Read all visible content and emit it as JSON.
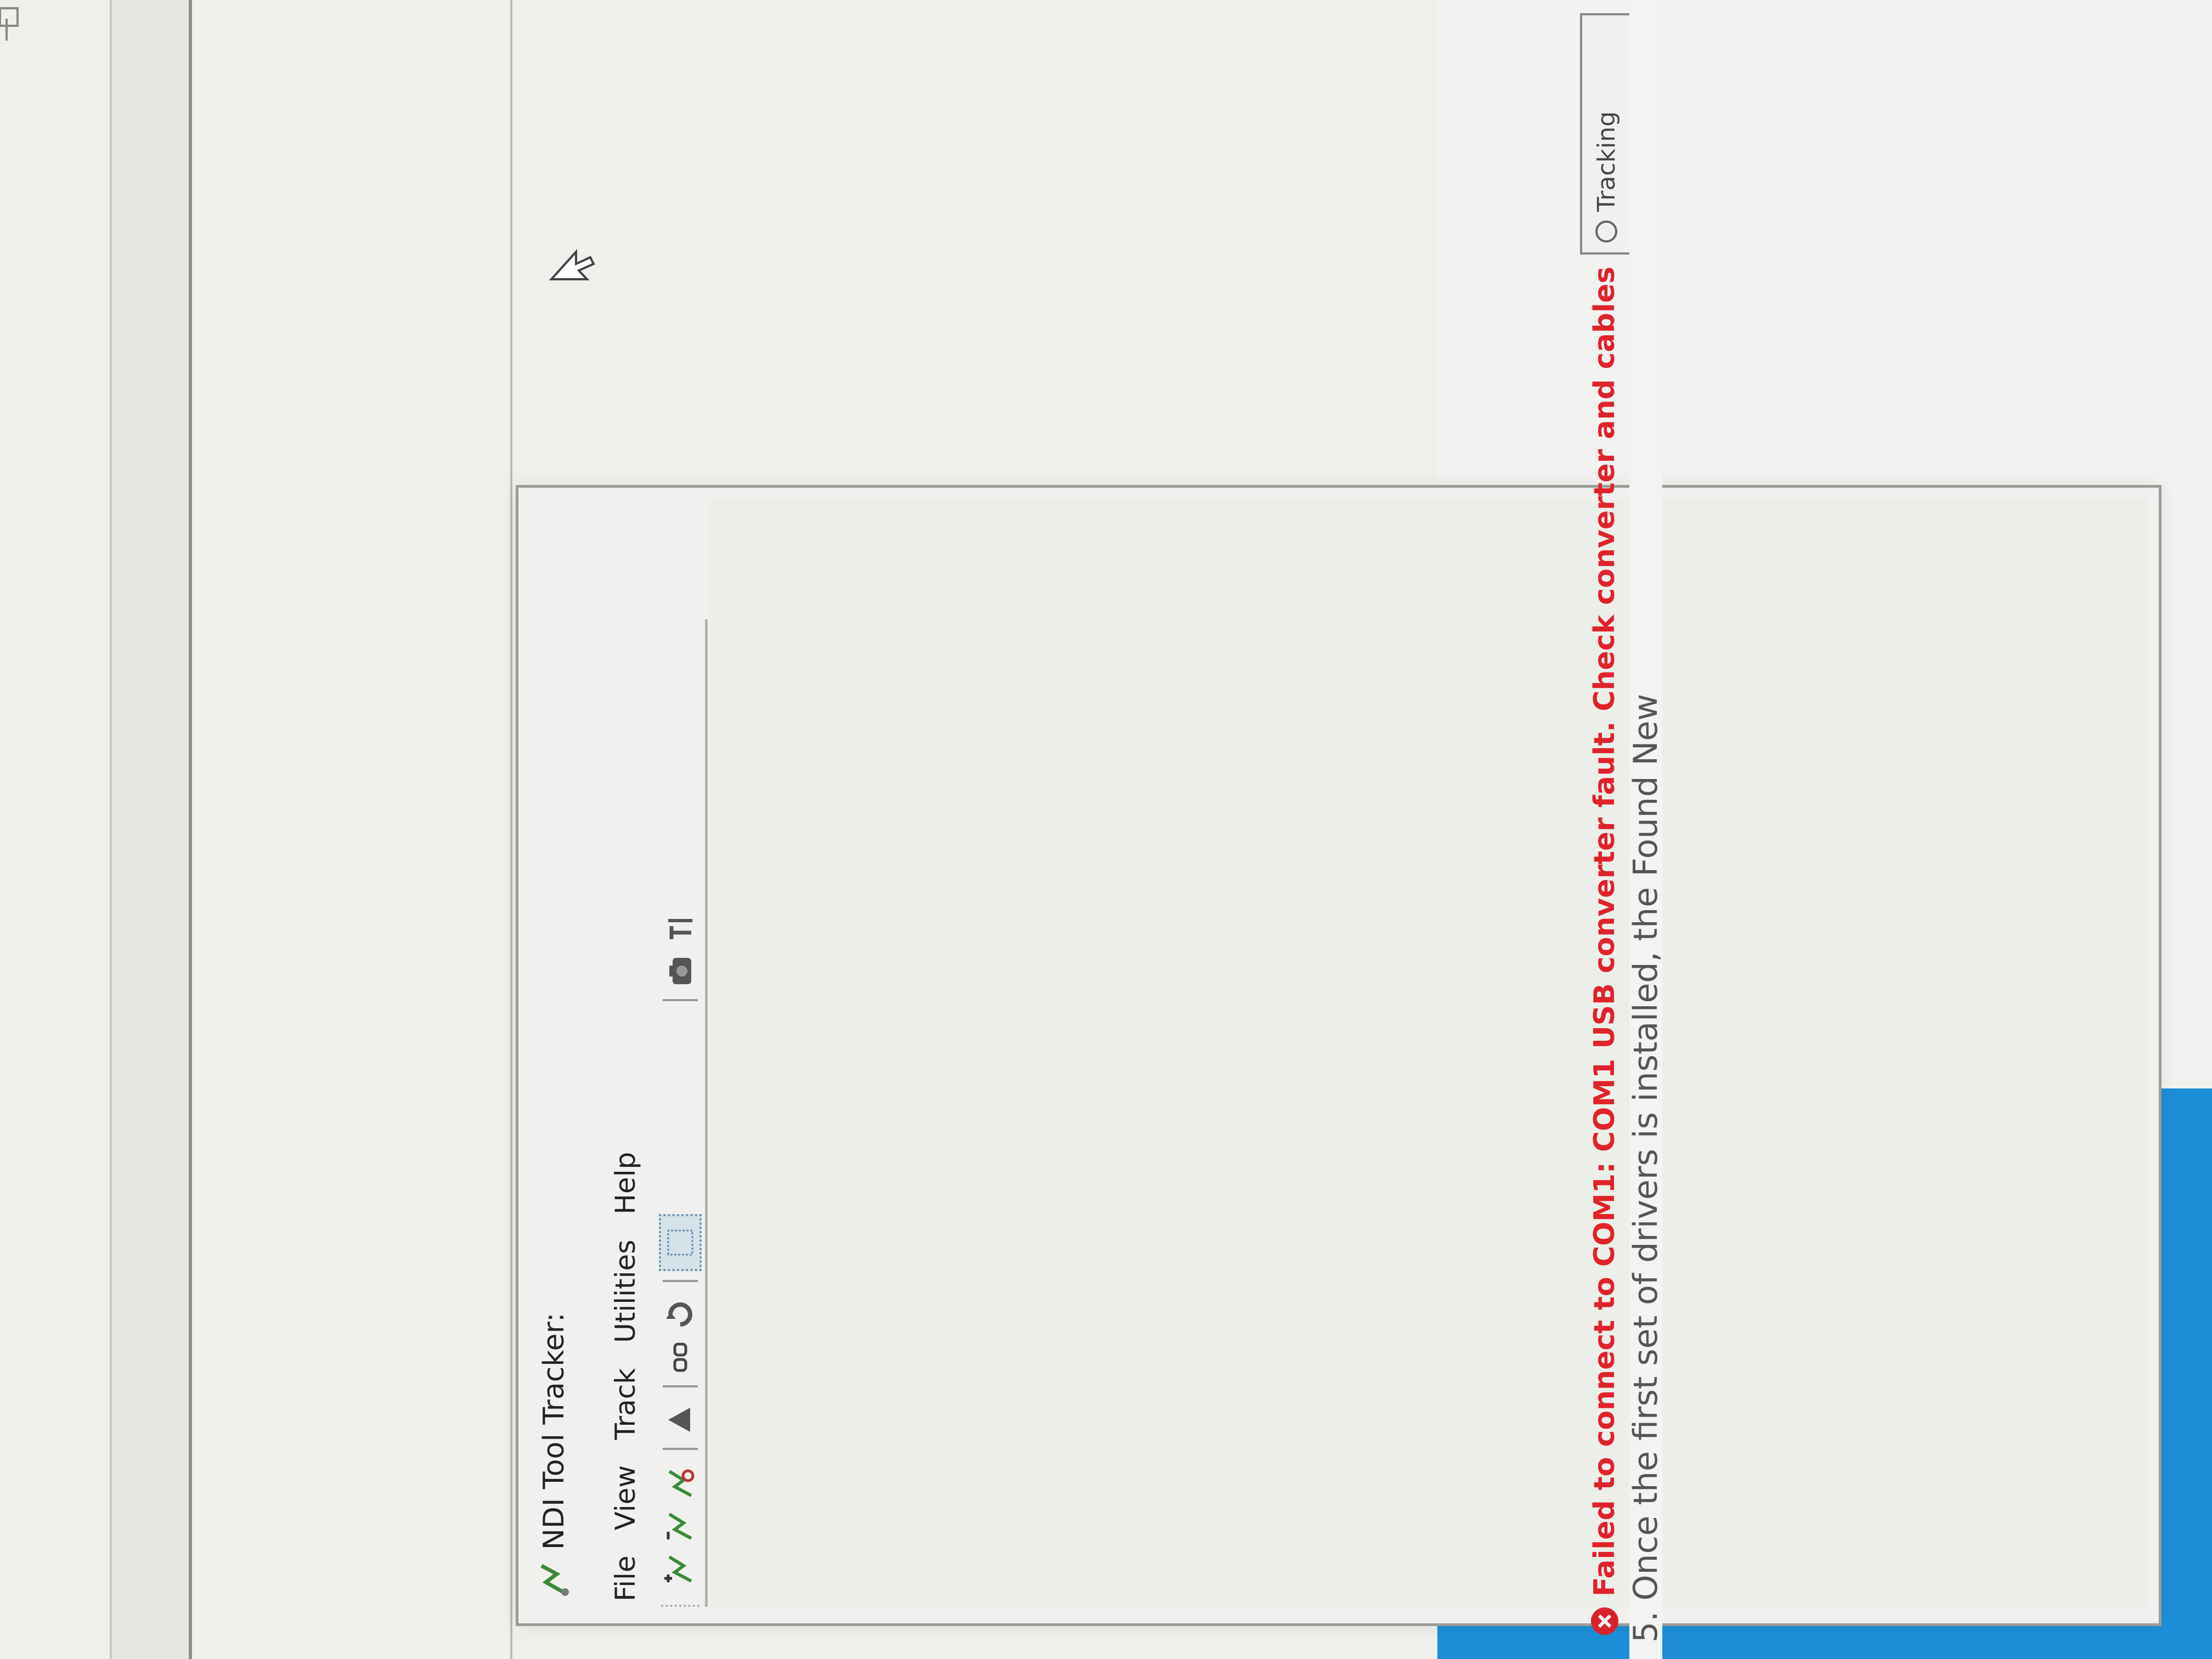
{
  "window": {
    "title": "NDI Tool Tracker:",
    "app_icon": "ndi-tool-tracker-icon"
  },
  "menu": {
    "items": [
      "File",
      "View",
      "Track",
      "Utilities",
      "Help"
    ]
  },
  "toolbar": {
    "buttons": [
      "add-tool-icon",
      "remove-tool-icon",
      "tool-properties-icon",
      "start-tracking-icon",
      "link-icon",
      "reset-icon",
      "grid-view-icon",
      "camera-icon",
      "tool-settings-icon"
    ]
  },
  "status": {
    "error_icon": "error-icon",
    "message": "Failed to connect to COM1: COM1 USB converter fault. Check converter and cables",
    "tracking_label": "Tracking",
    "error_color": "#e0222a"
  },
  "background_doc": {
    "partial_text": "5. Once the first set of drivers is installed, the Found New"
  },
  "colors": {
    "desktop_blue": "#1d8fd8",
    "window_bg": "#f0f1ee"
  }
}
